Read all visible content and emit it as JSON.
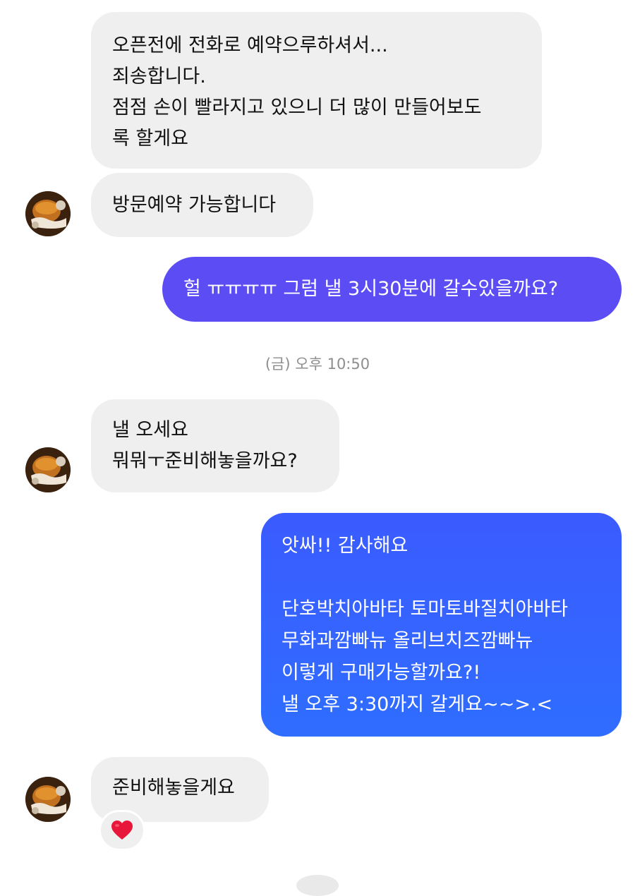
{
  "messages": {
    "m1": "오픈전에 전화로 예약으루하셔서...\n죄송합니다.\n점점 손이 빨라지고 있으니 더 많이 만들어보도\n록 할게요",
    "m2": "방문예약 가능합니다",
    "m3": "헐 ㅠㅠㅠㅠ 그럼 낼 3시30분에 갈수있을까요?",
    "m4": "낼 오세요\n뭐뭐ㅜ준비해놓을까요?",
    "m5": "앗싸!! 감사해요\n\n단호박치아바타 토마토바질치아바타\n무화과깜빠뉴 올리브치즈깜빠뉴\n이렇게 구매가능할까요?!\n낼 오후 3:30까지 갈게요~~>.<",
    "m6": "준비해놓을게요"
  },
  "timestamp": "(금) 오후 10:50",
  "reaction": "❤️",
  "colors": {
    "received_bg": "#efefef",
    "sent_purple": "#5b4cf3",
    "sent_blue_top": "#3b5bff",
    "sent_blue_bottom": "#2f6dff",
    "timestamp": "#8e8e8e",
    "heart": "#e8163a"
  },
  "icons": {
    "avatar": "profile-photo-avatar",
    "reaction": "heart-icon"
  }
}
